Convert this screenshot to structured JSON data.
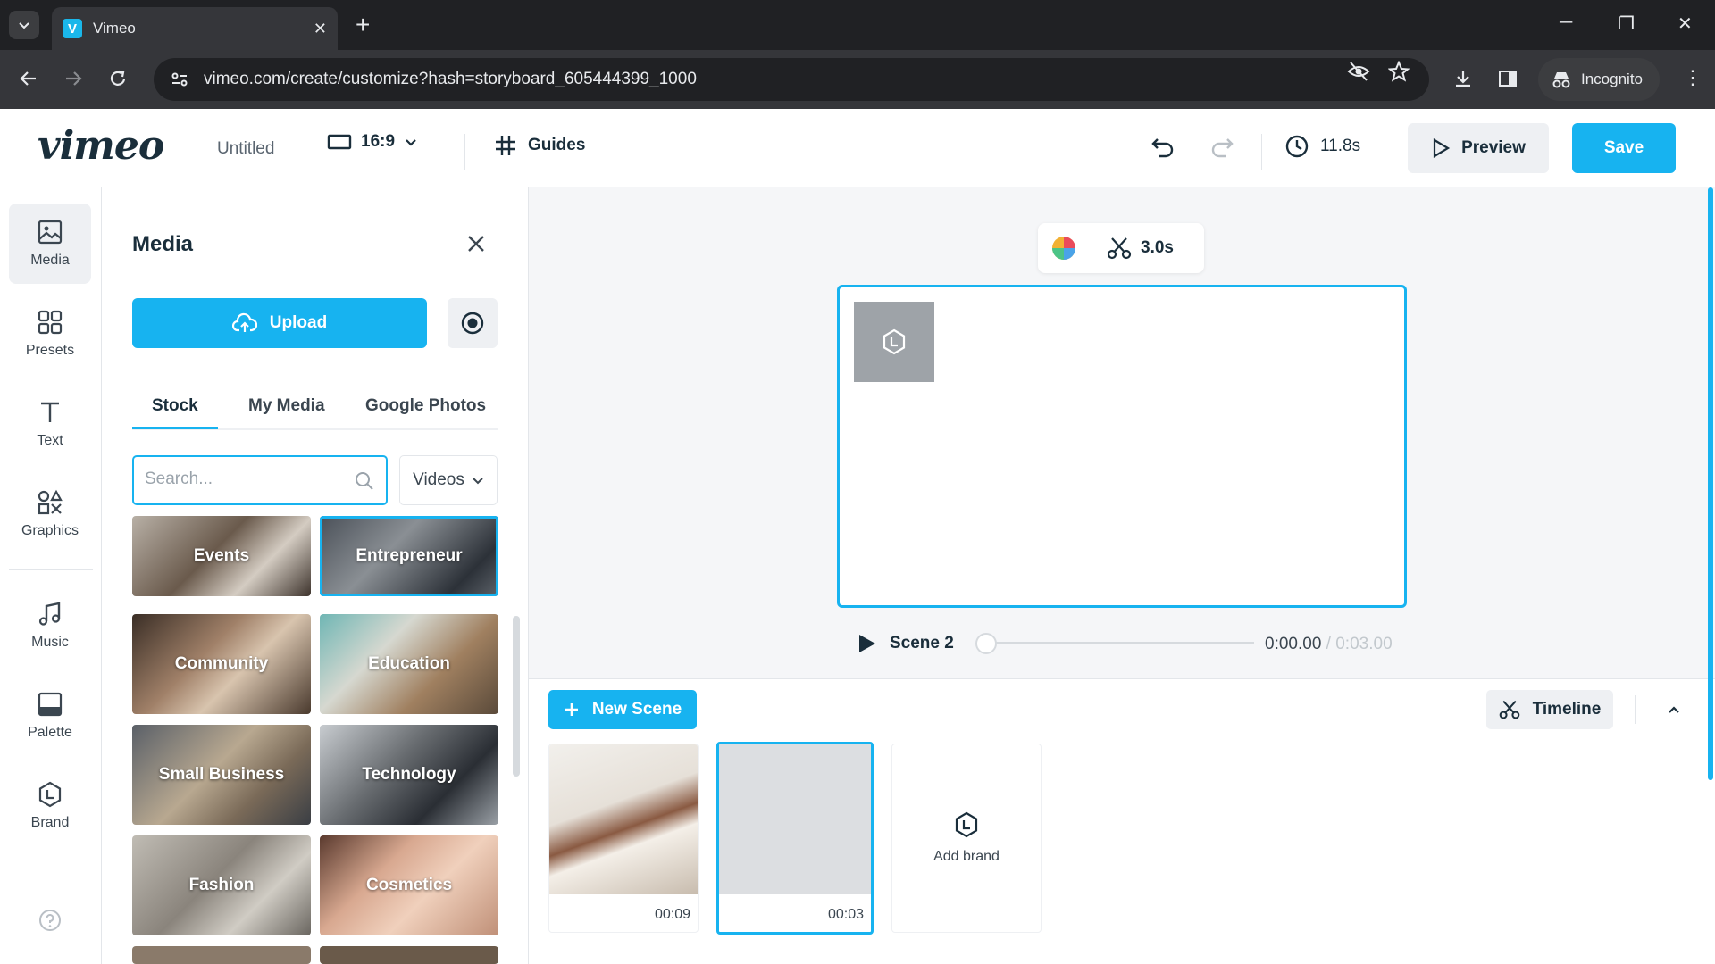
{
  "browser": {
    "tab_title": "Vimeo",
    "favicon_letter": "V",
    "url": "vimeo.com/create/customize?hash=storyboard_605444399_1000",
    "incognito_label": "Incognito"
  },
  "header": {
    "logo": "vimeo",
    "project_title": "Untitled",
    "aspect_ratio": "16:9",
    "guides_label": "Guides",
    "duration": "11.8s",
    "preview_label": "Preview",
    "save_label": "Save"
  },
  "rail": {
    "items": [
      {
        "label": "Media",
        "icon": "image-icon",
        "active": true
      },
      {
        "label": "Presets",
        "icon": "grid-icon"
      },
      {
        "label": "Text",
        "icon": "text-icon"
      },
      {
        "label": "Graphics",
        "icon": "shapes-icon"
      },
      {
        "label": "Music",
        "icon": "music-note-icon"
      },
      {
        "label": "Palette",
        "icon": "palette-icon"
      },
      {
        "label": "Brand",
        "icon": "brand-hexagon-icon"
      }
    ]
  },
  "media_panel": {
    "title": "Media",
    "upload_label": "Upload",
    "tabs": [
      "Stock",
      "My Media",
      "Google Photos"
    ],
    "active_tab": "Stock",
    "search_placeholder": "Search...",
    "filter_value": "Videos",
    "tiles": [
      {
        "label": "Events"
      },
      {
        "label": "Entrepreneur",
        "selected": true
      },
      {
        "label": "Community"
      },
      {
        "label": "Education"
      },
      {
        "label": "Small Business"
      },
      {
        "label": "Technology"
      },
      {
        "label": "Fashion"
      },
      {
        "label": "Cosmetics"
      }
    ]
  },
  "canvas": {
    "trim_duration": "3.0s",
    "scene_label": "Scene 2",
    "current_time": "0:00.00",
    "total_time": " / 0:03.00"
  },
  "scenes": {
    "new_scene_label": "New Scene",
    "timeline_label": "Timeline",
    "cards": [
      {
        "duration": "00:09"
      },
      {
        "duration": "00:03",
        "selected": true
      }
    ],
    "add_brand_label": "Add brand"
  },
  "colors": {
    "accent": "#17b3f0",
    "brand_dark": "#1a2e3b"
  }
}
